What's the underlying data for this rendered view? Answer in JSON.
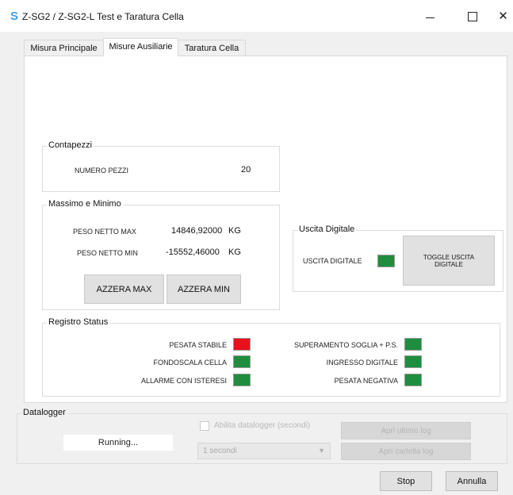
{
  "window": {
    "title": "Z-SG2 / Z-SG2-L Test e Taratura Cella",
    "app_icon": "S",
    "controls": {
      "minimize_icon": "minimize-icon",
      "maximize_icon": "maximize-icon",
      "close_icon": "close-icon",
      "close_glyph": "✕"
    }
  },
  "tabs": [
    {
      "label": "Misura Principale",
      "active": false
    },
    {
      "label": "Misure Ausiliarie",
      "active": true
    },
    {
      "label": "Taratura Cella",
      "active": false
    }
  ],
  "contapezzi": {
    "title": "Contapezzi",
    "numero_pezzi_label": "NUMERO PEZZI",
    "numero_pezzi_value": "20"
  },
  "massimo_minimo": {
    "title": "Massimo e  Minimo",
    "peso_max_label": "PESO NETTO MAX",
    "peso_max_value": "14846,92000",
    "peso_max_unit": "KG",
    "peso_min_label": "PESO NETTO MIN",
    "peso_min_value": "-15552,46000",
    "peso_min_unit": "KG",
    "azzera_max_label": "AZZERA MAX",
    "azzera_min_label": "AZZERA MIN"
  },
  "uscita_digitale": {
    "title": "Uscita Digitale",
    "label": "USCITA DIGITALE",
    "led_color": "#1e8e3e",
    "toggle_label": "TOGGLE USCITA DIGITALE"
  },
  "registro_status": {
    "title": "Registro Status",
    "left": [
      {
        "label": "PESATA STABILE",
        "color": "#e8101a"
      },
      {
        "label": "FONDOSCALA CELLA",
        "color": "#1e8e3e"
      },
      {
        "label": "ALLARME CON ISTERESI",
        "color": "#1e8e3e"
      }
    ],
    "right": [
      {
        "label": "SUPERAMENTO SOGLIA + P.S.",
        "color": "#1e8e3e"
      },
      {
        "label": "INGRESSO DIGITALE",
        "color": "#1e8e3e"
      },
      {
        "label": "PESATA NEGATIVA",
        "color": "#1e8e3e"
      }
    ]
  },
  "datalogger": {
    "title": "Datalogger",
    "status": "Running...",
    "checkbox_label": "Abilita datalogger (secondi)",
    "interval_value": "1 secondi",
    "open_file_label": "Apri ultimo log",
    "open_folder_label": "Apri cartella log"
  },
  "footer": {
    "stop_label": "Stop",
    "annulla_label": "Annulla"
  }
}
